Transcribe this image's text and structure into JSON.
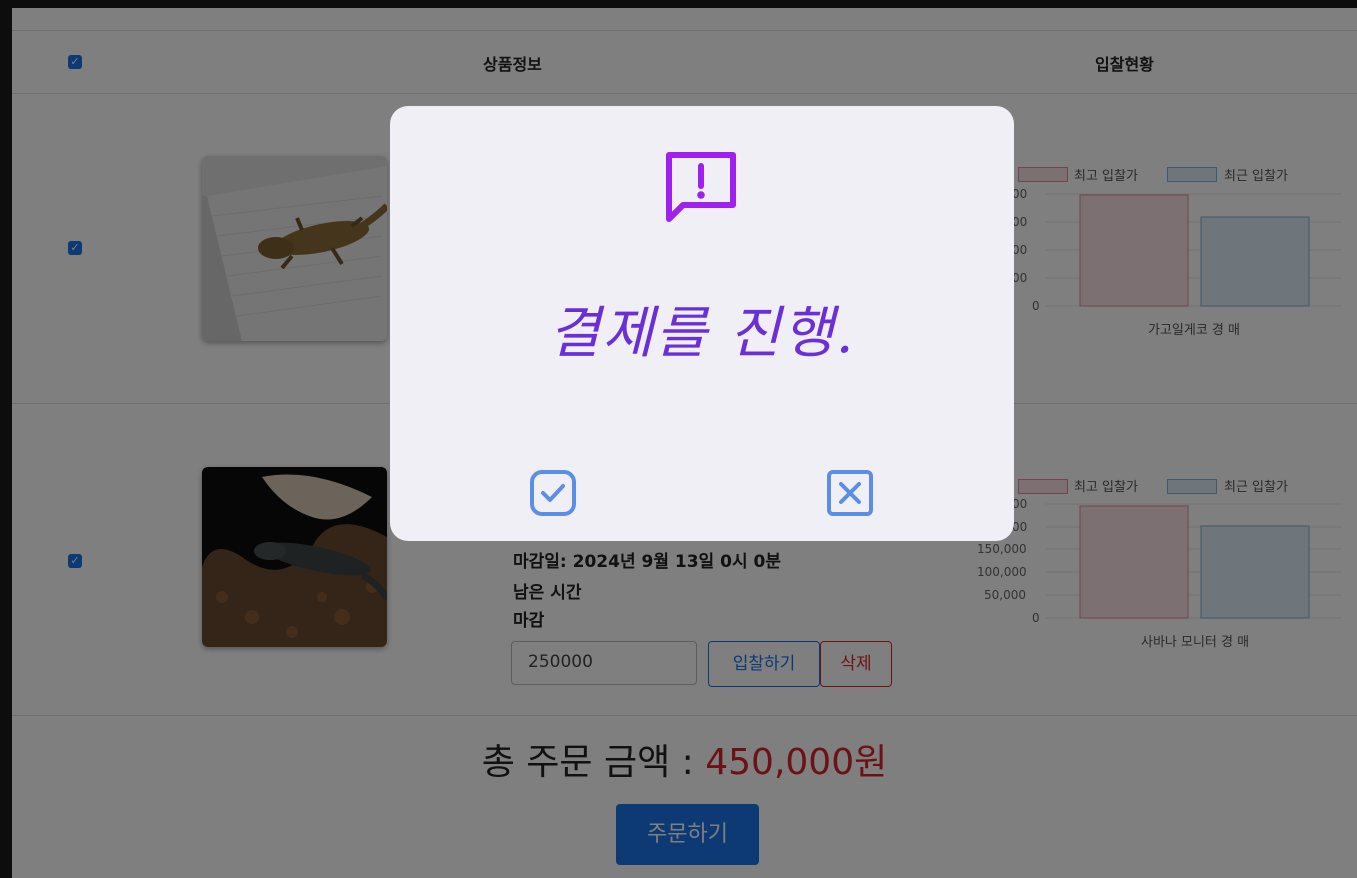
{
  "table": {
    "header": {
      "product_info": "상품정보",
      "bid_status": "입찰현황"
    }
  },
  "items": [
    {
      "checked": true,
      "image": "gecko-photo",
      "chart": {
        "legend_high": "최고 입찰가",
        "legend_recent": "최근 입찰가",
        "yticks": [
          "00",
          "00",
          "00",
          "00",
          "0"
        ],
        "category": "가고일게코 경 매"
      }
    },
    {
      "checked": true,
      "image": "monitor-lizard-photo",
      "deadline": "마감일: 2024년 9월 13일 0시 0분",
      "remaining_label": "남은 시간",
      "remaining_value": "마감",
      "bid_value": "250000",
      "bid_button": "입찰하기",
      "delete_button": "삭제",
      "chart": {
        "legend_high": "최고 입찰가",
        "legend_recent": "최근 입찰가",
        "yticks": [
          "00",
          "00",
          "150,000",
          "100,000",
          "50,000",
          "0"
        ],
        "category": "사바나 모니터 경 매"
      }
    }
  ],
  "total": {
    "label": "총 주문 금액 : ",
    "amount": "450,000원"
  },
  "order_button": "주문하기",
  "modal": {
    "message": "결제를 진행.",
    "confirm_icon": "check-icon",
    "cancel_icon": "close-icon",
    "alert_icon": "alert-message-icon"
  },
  "colors": {
    "accent_blue": "#1a73e8",
    "accent_red": "#d9242f",
    "modal_purple": "#a020f0",
    "bar_high": "#f4b6c2",
    "bar_recent": "#a8cbe8"
  }
}
